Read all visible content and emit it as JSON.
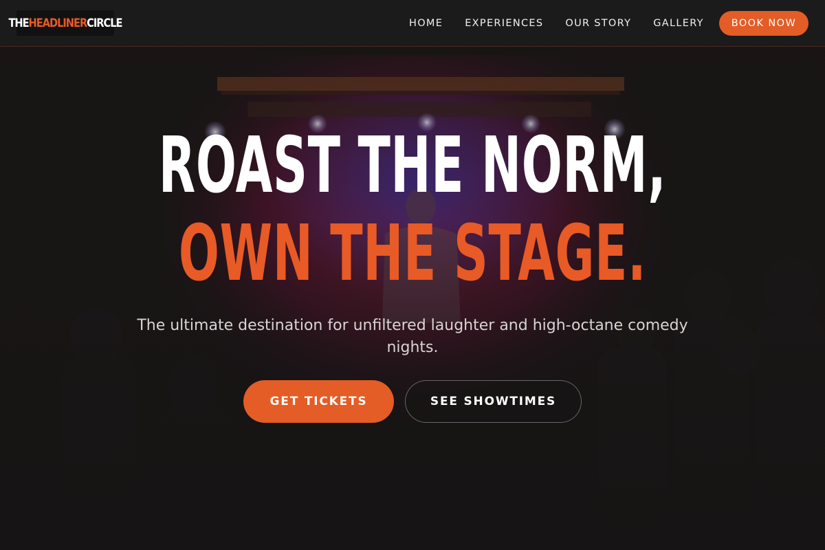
{
  "brand": {
    "logo_part1": "THE ",
    "logo_part2": "HEADLINER",
    "logo_part3": " CIRCLE"
  },
  "nav": {
    "items": [
      {
        "label": "HOME"
      },
      {
        "label": "EXPERIENCES"
      },
      {
        "label": "OUR STORY"
      },
      {
        "label": "GALLERY"
      }
    ],
    "cta_label": "BOOK NOW"
  },
  "hero": {
    "headline_line1": "ROAST THE NORM,",
    "headline_line2": "OWN THE STAGE.",
    "subtitle": "The ultimate destination for unfiltered laughter and high-octane comedy nights.",
    "primary_button": "GET TICKETS",
    "secondary_button": "SEE SHOWTIMES"
  },
  "colors": {
    "accent": "#e45c26",
    "background": "#161414",
    "navbar": "#1c1b1b"
  }
}
